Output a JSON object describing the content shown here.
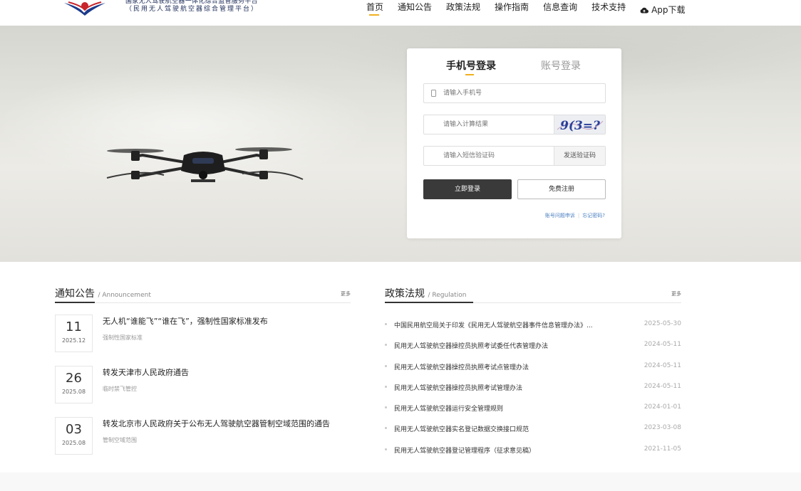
{
  "header": {
    "brand_line1": "国家无人驾驶航空器一体化综合监管服务平台",
    "brand_line2": "（民用无人驾驶航空器综合管理平台）",
    "nav": [
      {
        "label": "首页",
        "active": true
      },
      {
        "label": "通知公告"
      },
      {
        "label": "政策法规"
      },
      {
        "label": "操作指南"
      },
      {
        "label": "信息查询"
      },
      {
        "label": "技术支持"
      }
    ],
    "app_label": "App下载"
  },
  "login": {
    "tab_phone": "手机号登录",
    "tab_account": "账号登录",
    "phone_placeholder": "请输入手机号",
    "captcha_placeholder": "请输入计算结果",
    "captcha_text": "9(3=?",
    "sms_placeholder": "请输入短信验证码",
    "sms_button": "发送验证码",
    "login_button": "立即登录",
    "register_button": "免费注册",
    "link_appeal": "账号问题申诉",
    "link_forgot": "忘记密码?"
  },
  "notices": {
    "title": "通知公告",
    "title_en": "/ Announcement",
    "more": "更多",
    "items": [
      {
        "day": "11",
        "ym": "2025.12",
        "title": "无人机“谁能飞”“谁在飞”，强制性国家标准发布",
        "sub": "强制性国家标准"
      },
      {
        "day": "26",
        "ym": "2025.08",
        "title": "转发天津市人民政府通告",
        "sub": "临时禁飞管控"
      },
      {
        "day": "03",
        "ym": "2025.08",
        "title": "转发北京市人民政府关于公布无人驾驶航空器管制空域范围的通告",
        "sub": "管制空域范围"
      }
    ]
  },
  "regulations": {
    "title": "政策法规",
    "title_en": "/ Regulation",
    "more": "更多",
    "items": [
      {
        "title": "中国民用航空局关于印发《民用无人驾驶航空器事件信息管理办法》...",
        "date": "2025-05-30"
      },
      {
        "title": "民用无人驾驶航空器操控员执照考试委任代表管理办法",
        "date": "2024-05-11"
      },
      {
        "title": "民用无人驾驶航空器操控员执照考试点管理办法",
        "date": "2024-05-11"
      },
      {
        "title": "民用无人驾驶航空器操控员执照考试管理办法",
        "date": "2024-05-11"
      },
      {
        "title": "民用无人驾驶航空器运行安全管理规则",
        "date": "2024-01-01"
      },
      {
        "title": "民用无人驾驶航空器实名登记数据交换接口规范",
        "date": "2023-03-08"
      },
      {
        "title": "民用无人驾驶航空器登记管理程序（征求意见稿）",
        "date": "2021-11-05"
      }
    ]
  },
  "colors": {
    "accent": "#f2b01e",
    "dark_button": "#3a3a3a",
    "link": "#4a7fc1",
    "captcha_ink": "#2a3f9a"
  }
}
